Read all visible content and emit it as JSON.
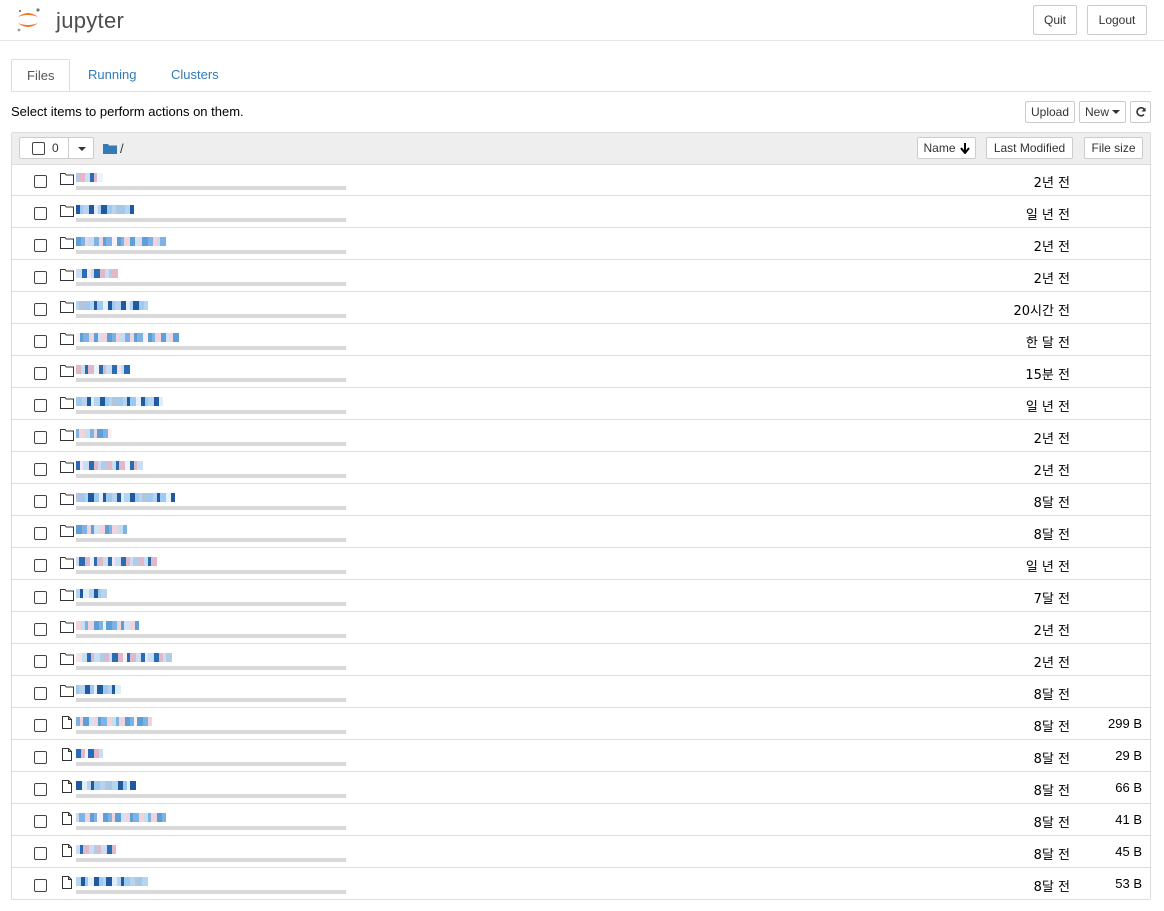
{
  "app": {
    "logo_text": "jupyter",
    "quit_label": "Quit",
    "logout_label": "Logout"
  },
  "tabs": [
    {
      "label": "Files",
      "active": true
    },
    {
      "label": "Running",
      "active": false
    },
    {
      "label": "Clusters",
      "active": false
    }
  ],
  "toolbar": {
    "hint": "Select items to perform actions on them.",
    "upload_label": "Upload",
    "new_label": "New",
    "refresh_icon": "refresh-icon"
  },
  "list_header": {
    "selected_count": "0",
    "path": "/",
    "name_label": "Name",
    "last_modified_label": "Last Modified",
    "file_size_label": "File size"
  },
  "items": [
    {
      "type": "folder",
      "name_redacted": true,
      "modified": "2년 전",
      "size": ""
    },
    {
      "type": "folder",
      "name_redacted": true,
      "modified": "일 년 전",
      "size": ""
    },
    {
      "type": "folder",
      "name_redacted": true,
      "modified": "2년 전",
      "size": ""
    },
    {
      "type": "folder",
      "name_redacted": true,
      "modified": "2년 전",
      "size": ""
    },
    {
      "type": "folder",
      "name_redacted": true,
      "modified": "20시간 전",
      "size": ""
    },
    {
      "type": "folder",
      "name_redacted": true,
      "modified": "한 달 전",
      "size": ""
    },
    {
      "type": "folder",
      "name_redacted": true,
      "modified": "15분 전",
      "size": ""
    },
    {
      "type": "folder",
      "name_redacted": true,
      "modified": "일 년 전",
      "size": ""
    },
    {
      "type": "folder",
      "name_redacted": true,
      "modified": "2년 전",
      "size": ""
    },
    {
      "type": "folder",
      "name_redacted": true,
      "modified": "2년 전",
      "size": ""
    },
    {
      "type": "folder",
      "name_redacted": true,
      "modified": "8달 전",
      "size": ""
    },
    {
      "type": "folder",
      "name_redacted": true,
      "modified": "8달 전",
      "size": ""
    },
    {
      "type": "folder",
      "name_redacted": true,
      "modified": "일 년 전",
      "size": ""
    },
    {
      "type": "folder",
      "name_redacted": true,
      "modified": "7달 전",
      "size": ""
    },
    {
      "type": "folder",
      "name_redacted": true,
      "modified": "2년 전",
      "size": ""
    },
    {
      "type": "folder",
      "name_redacted": true,
      "modified": "2년 전",
      "size": ""
    },
    {
      "type": "folder",
      "name_redacted": true,
      "modified": "8달 전",
      "size": ""
    },
    {
      "type": "file",
      "name_redacted": true,
      "modified": "8달 전",
      "size": "299 B"
    },
    {
      "type": "file",
      "name_redacted": true,
      "modified": "8달 전",
      "size": "29 B"
    },
    {
      "type": "file",
      "name_redacted": true,
      "modified": "8달 전",
      "size": "66 B"
    },
    {
      "type": "file",
      "name_redacted": true,
      "modified": "8달 전",
      "size": "41 B"
    },
    {
      "type": "file",
      "name_redacted": true,
      "modified": "8달 전",
      "size": "45 B"
    },
    {
      "type": "file",
      "name_redacted": true,
      "modified": "8달 전",
      "size": "53 B"
    }
  ]
}
